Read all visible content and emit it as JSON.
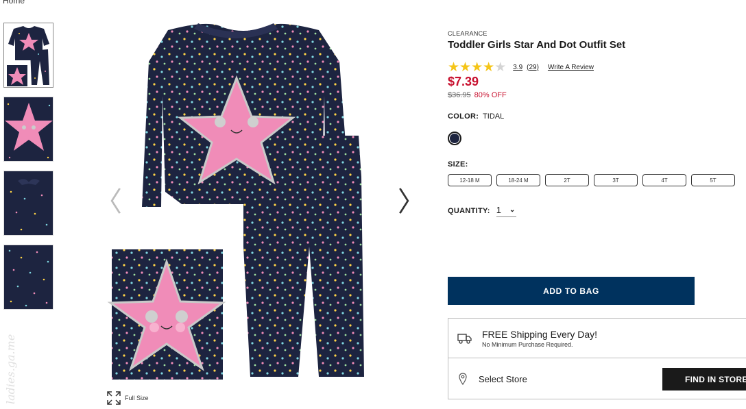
{
  "breadcrumb": {
    "home": "Home"
  },
  "gallery": {
    "thumbnails": [
      {
        "alt": "outfit set front"
      },
      {
        "alt": "star graphic close-up"
      },
      {
        "alt": "pants waistband detail"
      },
      {
        "alt": "star print fabric"
      }
    ],
    "fullsize_label": "Full Size",
    "watermark": "ladies.ga.me"
  },
  "product": {
    "badge": "CLEARANCE",
    "title": "Toddler Girls Star And Dot Outfit Set",
    "rating_value": "3.9",
    "rating_count": "(29)",
    "rating_stars": 3.9,
    "write_review": "Write A Review",
    "price": "$7.39",
    "original_price": "$36.95",
    "discount": "80% OFF",
    "color_label": "COLOR:",
    "color_value": "TIDAL",
    "swatch_color": "#1d2440",
    "size_label": "SIZE:",
    "sizes": [
      "12-18 M",
      "18-24 M",
      "2T",
      "3T",
      "4T",
      "5T"
    ],
    "quantity_label": "QUANTITY:",
    "quantity_value": "1",
    "add_to_bag": "ADD TO BAG"
  },
  "shipping": {
    "title": "FREE Shipping Every Day!",
    "subtitle": "No Minimum Purchase Required."
  },
  "store": {
    "label": "Select Store",
    "button": "FIND IN STORE"
  },
  "colors": {
    "navy_button": "#00325e",
    "sale_red": "#c8102e",
    "star_yellow": "#f5c518"
  }
}
